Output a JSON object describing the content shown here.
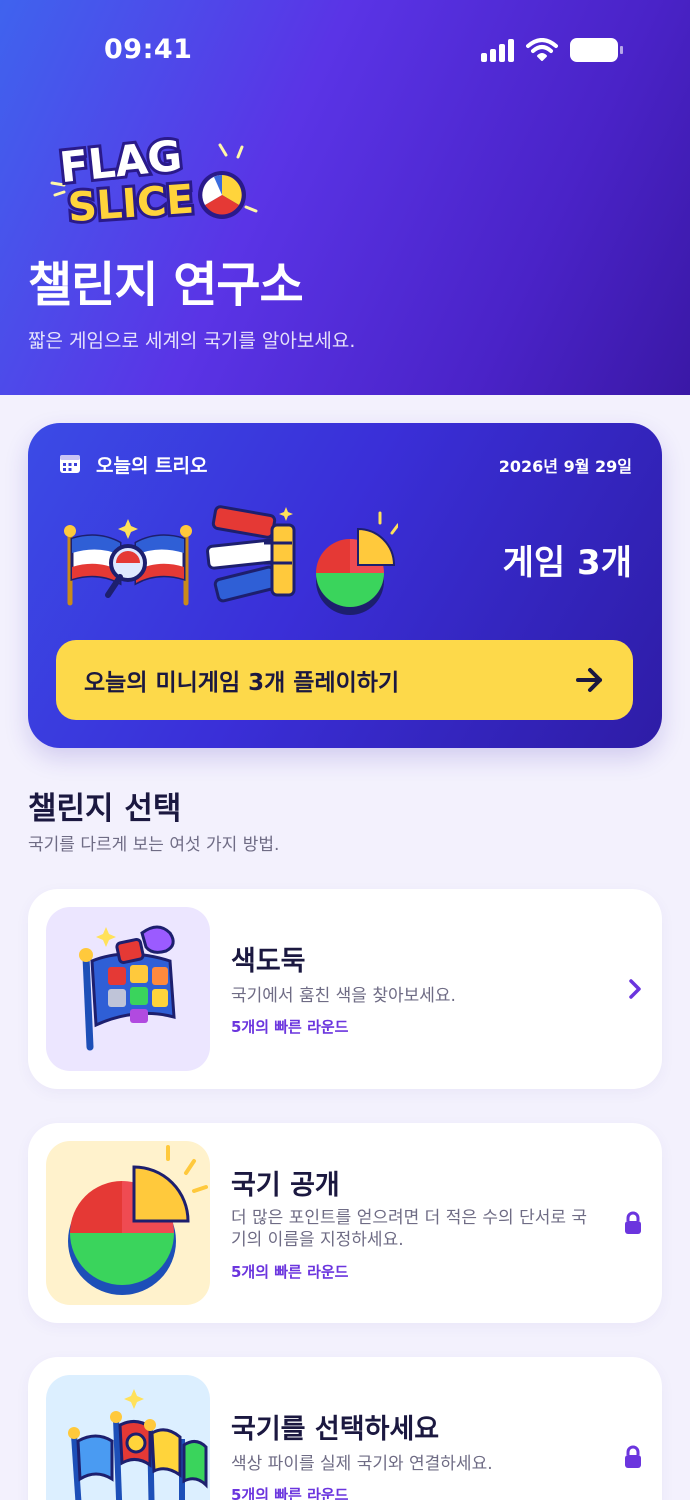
{
  "status_bar": {
    "time": "09:41",
    "icons": [
      "signal-icon",
      "wifi-icon",
      "battery-icon"
    ]
  },
  "header": {
    "logo_text": [
      "FLAG",
      "SLICE"
    ],
    "title": "챌린지 연구소",
    "subtitle": "짧은 게임으로 세계의 국기를 알아보세요."
  },
  "daily_trio": {
    "label": "오늘의 트리오",
    "date": "2026년 9월 29일",
    "game_count": "게임 3개",
    "play_button": "오늘의 미니게임 3개 플레이하기"
  },
  "challenges": {
    "title": "챌린지 선택",
    "subtitle": "국기를 다르게 보는 여섯 가지 방법.",
    "items": [
      {
        "title": "색도둑",
        "description": "국기에서 훔친 색을 찾아보세요.",
        "meta": "5개의 빠른 라운드",
        "status": "unlocked"
      },
      {
        "title": "국기 공개",
        "description": "더 많은 포인트를 얻으려면 더 적은 수의 단서로 국기의 이름을 지정하세요.",
        "meta": "5개의 빠른 라운드",
        "status": "locked"
      },
      {
        "title": "국기를 선택하세요",
        "description": "색상 파이를 실제 국기와 연결하세요.",
        "meta": "5개의 빠른 라운드",
        "status": "locked"
      }
    ]
  },
  "colors": {
    "accent_purple": "#6b35de",
    "cta_yellow": "#fdd94a",
    "hero_gradient": [
      "#3f63ee",
      "#5a34e6",
      "#3a18a6"
    ],
    "background": "#f3f1fd"
  }
}
